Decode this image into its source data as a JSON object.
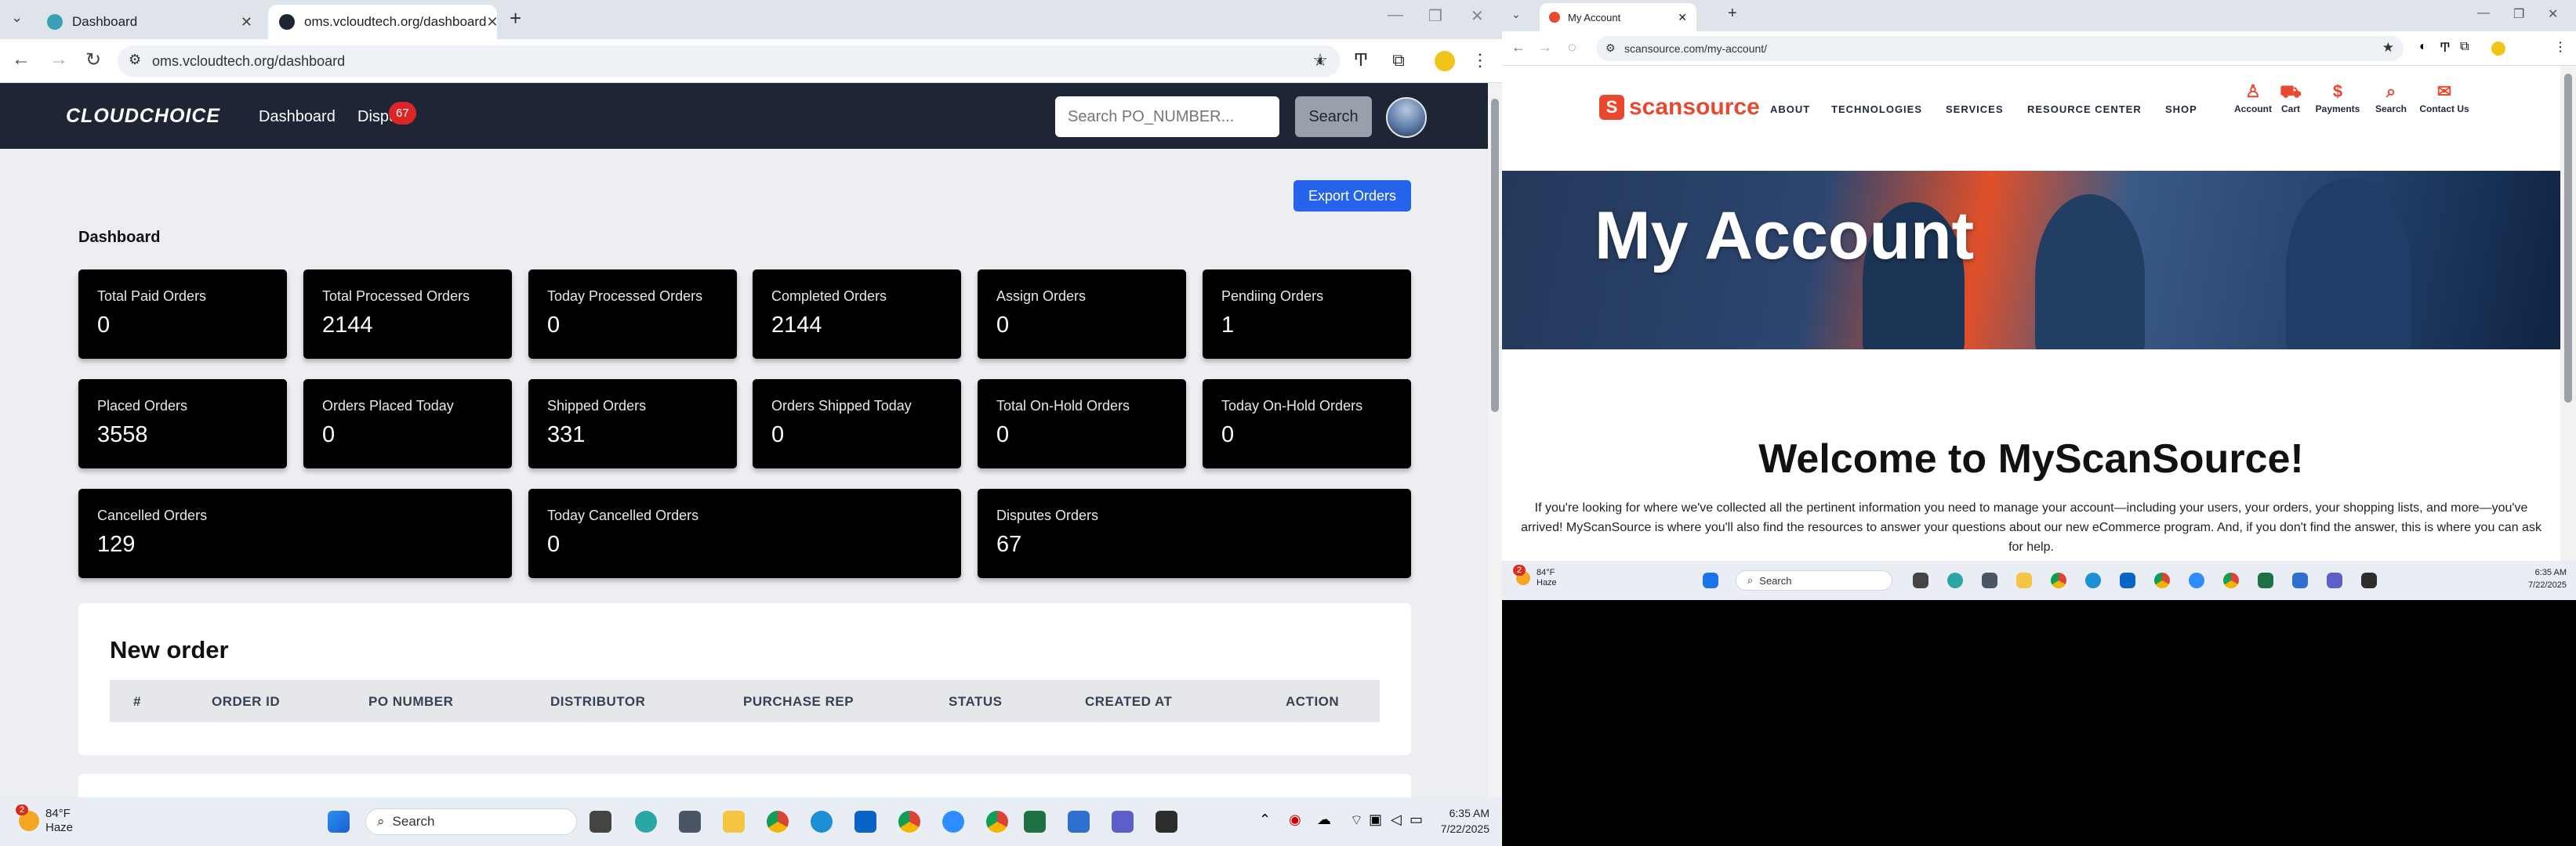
{
  "left": {
    "tabs": [
      {
        "title": "Dashboard"
      },
      {
        "title": "oms.vcloudtech.org/dashboard"
      }
    ],
    "new_tab": "+",
    "url": "oms.vcloudtech.org/dashboard",
    "app": {
      "logo": "CLOUDCHOICE",
      "nav": [
        {
          "label": "Dashboard"
        },
        {
          "label": "Dispu"
        }
      ],
      "disputes_badge": "67",
      "search_placeholder": "Search PO_NUMBER...",
      "search_button": "Search"
    },
    "export_button": "Export Orders",
    "section_title": "Dashboard",
    "cards": [
      {
        "label": "Total Paid Orders",
        "value": "0"
      },
      {
        "label": "Total Processed Orders",
        "value": "2144"
      },
      {
        "label": "Today Processed Orders",
        "value": "0"
      },
      {
        "label": "Completed Orders",
        "value": "2144"
      },
      {
        "label": "Assign Orders",
        "value": "0"
      },
      {
        "label": "Pendiing Orders",
        "value": "1"
      },
      {
        "label": "Placed Orders",
        "value": "3558"
      },
      {
        "label": "Orders Placed Today",
        "value": "0"
      },
      {
        "label": "Shipped Orders",
        "value": "331"
      },
      {
        "label": "Orders Shipped Today",
        "value": "0"
      },
      {
        "label": "Total On-Hold Orders",
        "value": "0"
      },
      {
        "label": "Today On-Hold Orders",
        "value": "0"
      },
      {
        "label": "Cancelled Orders",
        "value": "129"
      },
      {
        "label": "Today Cancelled Orders",
        "value": "0"
      },
      {
        "label": "Disputes Orders",
        "value": "67"
      }
    ],
    "new_order": {
      "title": "New order",
      "columns": [
        "#",
        "ORDER ID",
        "PO NUMBER",
        "DISTRIBUTOR",
        "PURCHASE REP",
        "STATUS",
        "CREATED AT",
        "ACTION"
      ]
    },
    "taskbar": {
      "weather_temp": "84°F",
      "weather_desc": "Haze",
      "weather_badge": "2",
      "search": "Search",
      "time": "6:35 AM",
      "date": "7/22/2025"
    }
  },
  "right": {
    "tab_title": "My Account",
    "new_tab": "+",
    "url": "scansource.com/my-account/",
    "logo": "scansource",
    "nav": [
      "ABOUT",
      "TECHNOLOGIES",
      "SERVICES",
      "RESOURCE CENTER",
      "SHOP"
    ],
    "icons": [
      {
        "label": "Account",
        "icon": "person-icon"
      },
      {
        "label": "Cart",
        "icon": "cart-icon"
      },
      {
        "label": "Payments",
        "icon": "dollar-icon"
      },
      {
        "label": "Search",
        "icon": "search-icon"
      },
      {
        "label": "Contact Us",
        "icon": "chat-icon"
      }
    ],
    "hero_title": "My Account",
    "welcome": "Welcome to MyScanSource!",
    "paragraph": "If you're looking for where we've collected all the pertinent information you need to manage your account—including your users, your orders, your shopping lists, and more—you've arrived! MyScanSource is where you'll also find the resources to answer your questions about our new eCommerce program. And, if you don't find the answer, this is where you can ask for help.",
    "taskbar": {
      "weather_temp": "84°F",
      "weather_desc": "Haze",
      "weather_badge": "2",
      "search": "Search",
      "time": "6:35 AM",
      "date": "7/22/2025"
    }
  },
  "colors": {
    "appbar": "#1e2636",
    "card": "#000000",
    "accent_blue": "#2563eb",
    "badge_red": "#dc2626",
    "scansource_red": "#e9492f"
  }
}
